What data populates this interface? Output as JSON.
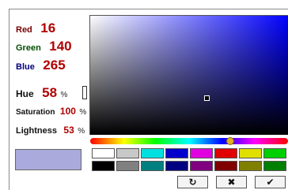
{
  "rgb": {
    "red": {
      "label": "Red",
      "value": "16",
      "label_color": "#7a0000"
    },
    "green": {
      "label": "Green",
      "value": "140",
      "label_color": "#004d00"
    },
    "blue": {
      "label": "Blue",
      "value": "265",
      "label_color": "#00007a"
    }
  },
  "hsl": {
    "hue": {
      "label": "Hue",
      "value": "58",
      "unit": "%"
    },
    "saturation": {
      "label": "Saturation",
      "value": "100",
      "unit": "%"
    },
    "lightness": {
      "label": "Lightness",
      "value": "53",
      "unit": "%"
    }
  },
  "preview_color": "#aaaadd",
  "picker": {
    "hue_color": "#0000ff"
  },
  "swatches": {
    "row1": [
      "#ffffff",
      "#c8c8c8",
      "#00e0e0",
      "#0000cc",
      "#e000e0",
      "#e00000",
      "#e0e000",
      "#00d000"
    ],
    "row2": [
      "#000000",
      "#808080",
      "#008080",
      "#000080",
      "#800080",
      "#800000",
      "#808000",
      "#008000"
    ]
  },
  "buttons": {
    "reset": {
      "icon": "reset-icon",
      "glyph": "↻"
    },
    "cancel": {
      "icon": "cancel-icon",
      "glyph": "✖"
    },
    "ok": {
      "icon": "check-icon",
      "glyph": "✔"
    }
  }
}
